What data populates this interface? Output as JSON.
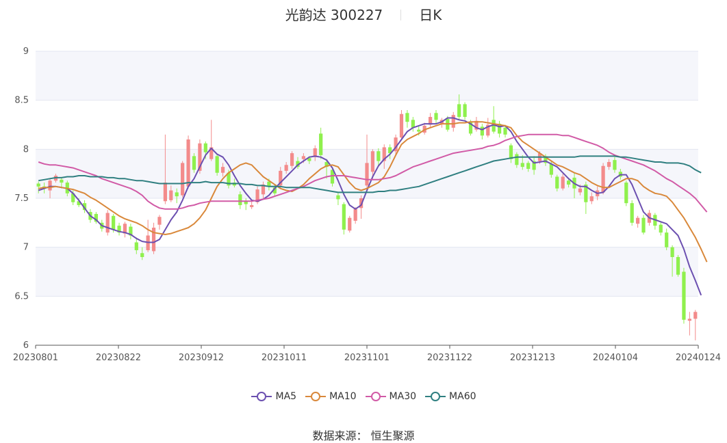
{
  "title": {
    "name": "光韵达 300227",
    "period": "日K"
  },
  "source": "数据来源：  恒生聚源",
  "chart_data": {
    "type": "candlestick",
    "ylim": [
      6,
      9
    ],
    "yticks": [
      "6",
      "6.5",
      "7",
      "7.5",
      "8",
      "8.5",
      "9"
    ],
    "xticks": [
      "20230801",
      "20230822",
      "20230912",
      "20231011",
      "20231101",
      "20231122",
      "20231213",
      "20240104",
      "20240124"
    ],
    "up_color": "#f38b8b",
    "down_color": "#8ff04d",
    "legend": [
      {
        "name": "MA5",
        "color": "#6b4fb0"
      },
      {
        "name": "MA10",
        "color": "#d9883a"
      },
      {
        "name": "MA30",
        "color": "#d15aa6"
      },
      {
        "name": "MA60",
        "color": "#2f7f80"
      }
    ],
    "candles": [
      [
        7.65,
        7.62,
        7.67,
        7.55
      ],
      [
        7.62,
        7.6,
        7.66,
        7.55
      ],
      [
        7.58,
        7.68,
        7.7,
        7.5
      ],
      [
        7.68,
        7.73,
        7.75,
        7.66
      ],
      [
        7.69,
        7.66,
        7.71,
        7.6
      ],
      [
        7.66,
        7.55,
        7.68,
        7.52
      ],
      [
        7.55,
        7.46,
        7.58,
        7.43
      ],
      [
        7.47,
        7.43,
        7.5,
        7.41
      ],
      [
        7.45,
        7.38,
        7.48,
        7.35
      ],
      [
        7.36,
        7.28,
        7.39,
        7.25
      ],
      [
        7.34,
        7.26,
        7.36,
        7.24
      ],
      [
        7.25,
        7.19,
        7.28,
        7.16
      ],
      [
        7.15,
        7.35,
        7.38,
        7.12
      ],
      [
        7.32,
        7.18,
        7.34,
        7.15
      ],
      [
        7.22,
        7.15,
        7.25,
        7.12
      ],
      [
        7.14,
        7.24,
        7.26,
        7.1
      ],
      [
        7.21,
        7.12,
        7.24,
        7.08
      ],
      [
        7.05,
        6.97,
        7.1,
        6.93
      ],
      [
        6.94,
        6.9,
        7.0,
        6.87
      ],
      [
        6.97,
        7.12,
        7.28,
        6.95
      ],
      [
        6.96,
        7.2,
        7.25,
        6.93
      ],
      [
        7.23,
        7.31,
        7.33,
        7.18
      ],
      [
        7.47,
        7.66,
        8.15,
        7.44
      ],
      [
        7.48,
        7.58,
        7.63,
        7.46
      ],
      [
        7.56,
        7.52,
        7.6,
        7.45
      ],
      [
        7.53,
        7.86,
        7.88,
        7.51
      ],
      [
        7.62,
        8.1,
        8.14,
        7.6
      ],
      [
        7.93,
        7.79,
        7.96,
        7.76
      ],
      [
        7.78,
        8.06,
        8.1,
        7.75
      ],
      [
        8.06,
        7.97,
        8.08,
        7.9
      ],
      [
        7.9,
        8.02,
        8.3,
        7.88
      ],
      [
        7.93,
        7.76,
        7.95,
        7.73
      ],
      [
        7.76,
        7.82,
        7.86,
        7.72
      ],
      [
        7.76,
        7.63,
        7.79,
        7.6
      ],
      [
        7.66,
        7.63,
        7.7,
        7.61
      ],
      [
        7.54,
        7.43,
        7.57,
        7.39
      ],
      [
        7.47,
        7.44,
        7.5,
        7.38
      ],
      [
        7.41,
        7.43,
        7.47,
        7.39
      ],
      [
        7.46,
        7.59,
        7.62,
        7.44
      ],
      [
        7.54,
        7.64,
        7.67,
        7.5
      ],
      [
        7.67,
        7.62,
        7.7,
        7.58
      ],
      [
        7.61,
        7.55,
        7.64,
        7.52
      ],
      [
        7.63,
        7.78,
        7.82,
        7.6
      ],
      [
        7.78,
        7.84,
        7.87,
        7.75
      ],
      [
        7.83,
        7.96,
        7.98,
        7.8
      ],
      [
        7.88,
        7.82,
        7.92,
        7.8
      ],
      [
        7.9,
        7.93,
        7.96,
        7.86
      ],
      [
        7.91,
        7.88,
        7.93,
        7.85
      ],
      [
        7.92,
        8.01,
        8.04,
        7.88
      ],
      [
        8.16,
        7.94,
        8.22,
        7.9
      ],
      [
        7.87,
        7.82,
        7.9,
        7.7
      ],
      [
        7.79,
        7.65,
        7.81,
        7.62
      ],
      [
        7.53,
        7.49,
        7.56,
        7.43
      ],
      [
        7.44,
        7.18,
        7.46,
        7.13
      ],
      [
        7.17,
        7.3,
        7.32,
        7.15
      ],
      [
        7.27,
        7.39,
        7.41,
        7.24
      ],
      [
        7.4,
        7.5,
        7.53,
        7.29
      ],
      [
        7.63,
        7.86,
        8.15,
        7.58
      ],
      [
        7.77,
        7.98,
        8.0,
        7.7
      ],
      [
        7.98,
        7.88,
        8.01,
        7.82
      ],
      [
        7.88,
        8.02,
        8.05,
        7.8
      ],
      [
        8.02,
        7.96,
        8.05,
        7.9
      ],
      [
        7.98,
        8.12,
        8.15,
        7.95
      ],
      [
        8.12,
        8.36,
        8.4,
        8.1
      ],
      [
        8.37,
        8.28,
        8.4,
        8.22
      ],
      [
        8.3,
        8.22,
        8.33,
        8.18
      ],
      [
        8.2,
        8.18,
        8.24,
        8.14
      ],
      [
        8.17,
        8.24,
        8.27,
        8.15
      ],
      [
        8.25,
        8.33,
        8.37,
        8.22
      ],
      [
        8.37,
        8.3,
        8.4,
        8.26
      ],
      [
        8.26,
        8.3,
        8.32,
        8.22
      ],
      [
        8.31,
        8.2,
        8.34,
        8.18
      ],
      [
        8.22,
        8.35,
        8.38,
        8.18
      ],
      [
        8.46,
        8.33,
        8.56,
        8.3
      ],
      [
        8.46,
        8.33,
        8.48,
        8.3
      ],
      [
        8.28,
        8.16,
        8.3,
        8.14
      ],
      [
        8.2,
        8.29,
        8.33,
        8.18
      ],
      [
        8.23,
        8.14,
        8.26,
        8.1
      ],
      [
        8.14,
        8.25,
        8.32,
        8.12
      ],
      [
        8.3,
        8.18,
        8.44,
        8.16
      ],
      [
        8.26,
        8.16,
        8.29,
        8.12
      ],
      [
        8.22,
        8.15,
        8.25,
        8.12
      ],
      [
        8.04,
        7.9,
        8.06,
        7.86
      ],
      [
        7.95,
        7.84,
        7.97,
        7.81
      ],
      [
        7.86,
        7.82,
        7.94,
        7.79
      ],
      [
        7.86,
        7.8,
        7.88,
        7.77
      ],
      [
        7.88,
        7.79,
        7.93,
        7.74
      ],
      [
        7.88,
        7.96,
        7.98,
        7.85
      ],
      [
        7.93,
        7.86,
        7.95,
        7.83
      ],
      [
        7.85,
        7.74,
        7.88,
        7.71
      ],
      [
        7.72,
        7.6,
        7.74,
        7.57
      ],
      [
        7.6,
        7.72,
        7.75,
        7.58
      ],
      [
        7.68,
        7.64,
        7.71,
        7.61
      ],
      [
        7.71,
        7.6,
        7.76,
        7.5
      ],
      [
        7.56,
        7.6,
        7.64,
        7.53
      ],
      [
        7.64,
        7.46,
        7.67,
        7.34
      ],
      [
        7.47,
        7.52,
        7.56,
        7.44
      ],
      [
        7.52,
        7.58,
        7.62,
        7.48
      ],
      [
        7.56,
        7.83,
        7.86,
        7.54
      ],
      [
        7.82,
        7.87,
        7.9,
        7.79
      ],
      [
        7.89,
        7.79,
        7.92,
        7.76
      ],
      [
        7.77,
        7.72,
        7.8,
        7.69
      ],
      [
        7.66,
        7.45,
        7.68,
        7.42
      ],
      [
        7.45,
        7.25,
        7.48,
        7.22
      ],
      [
        7.24,
        7.3,
        7.32,
        7.2
      ],
      [
        7.3,
        7.15,
        7.33,
        7.13
      ],
      [
        7.25,
        7.35,
        7.38,
        7.22
      ],
      [
        7.33,
        7.22,
        7.35,
        7.18
      ],
      [
        7.23,
        7.15,
        7.26,
        7.12
      ],
      [
        7.15,
        7.0,
        7.19,
        6.97
      ],
      [
        7.0,
        6.9,
        7.02,
        6.7
      ],
      [
        6.9,
        6.72,
        6.92,
        6.7
      ],
      [
        6.75,
        6.26,
        6.79,
        6.22
      ],
      [
        6.25,
        6.27,
        6.34,
        6.1
      ],
      [
        6.27,
        6.34,
        6.36,
        6.05
      ]
    ],
    "ma": {
      "MA5": [
        7.58,
        7.6,
        7.62,
        7.62,
        7.61,
        7.6,
        7.55,
        7.48,
        7.4,
        7.32,
        7.28,
        7.22,
        7.2,
        7.18,
        7.16,
        7.15,
        7.13,
        7.09,
        7.06,
        7.05,
        7.05,
        7.08,
        7.18,
        7.28,
        7.36,
        7.48,
        7.62,
        7.7,
        7.82,
        7.94,
        8.01,
        7.95,
        7.92,
        7.84,
        7.73,
        7.63,
        7.55,
        7.48,
        7.47,
        7.49,
        7.53,
        7.6,
        7.66,
        7.72,
        7.78,
        7.84,
        7.88,
        7.92,
        7.93,
        7.92,
        7.89,
        7.81,
        7.68,
        7.54,
        7.43,
        7.39,
        7.43,
        7.58,
        7.72,
        7.83,
        7.9,
        7.95,
        8.02,
        8.1,
        8.18,
        8.22,
        8.24,
        8.26,
        8.26,
        8.26,
        8.28,
        8.32,
        8.32,
        8.3,
        8.29,
        8.26,
        8.22,
        8.2,
        8.23,
        8.25,
        8.23,
        8.24,
        8.18,
        8.08,
        8.0,
        7.92,
        7.86,
        7.87,
        7.88,
        7.85,
        7.82,
        7.76,
        7.7,
        7.65,
        7.62,
        7.62,
        7.58,
        7.55,
        7.56,
        7.62,
        7.7,
        7.74,
        7.74,
        7.64,
        7.5,
        7.36,
        7.3,
        7.28,
        7.26,
        7.24,
        7.18,
        7.12,
        6.98,
        6.8,
        6.66,
        6.51
      ],
      "MA10": [
        7.6,
        7.61,
        7.61,
        7.62,
        7.61,
        7.6,
        7.59,
        7.57,
        7.55,
        7.51,
        7.48,
        7.44,
        7.4,
        7.36,
        7.32,
        7.29,
        7.27,
        7.25,
        7.22,
        7.18,
        7.15,
        7.14,
        7.13,
        7.14,
        7.16,
        7.18,
        7.2,
        7.24,
        7.3,
        7.38,
        7.5,
        7.62,
        7.7,
        7.76,
        7.8,
        7.84,
        7.86,
        7.84,
        7.78,
        7.72,
        7.68,
        7.64,
        7.6,
        7.58,
        7.57,
        7.6,
        7.64,
        7.7,
        7.75,
        7.8,
        7.83,
        7.84,
        7.82,
        7.74,
        7.66,
        7.6,
        7.58,
        7.6,
        7.63,
        7.66,
        7.72,
        7.82,
        7.94,
        8.05,
        8.1,
        8.13,
        8.16,
        8.2,
        8.22,
        8.24,
        8.26,
        8.26,
        8.26,
        8.27,
        8.27,
        8.28,
        8.28,
        8.28,
        8.27,
        8.26,
        8.25,
        8.24,
        8.22,
        8.14,
        8.08,
        8.04,
        8.0,
        7.96,
        7.92,
        7.88,
        7.84,
        7.82,
        7.79,
        7.76,
        7.74,
        7.7,
        7.66,
        7.63,
        7.61,
        7.61,
        7.64,
        7.67,
        7.7,
        7.7,
        7.68,
        7.62,
        7.58,
        7.55,
        7.54,
        7.52,
        7.46,
        7.38,
        7.3,
        7.2,
        7.1,
        6.98,
        6.85
      ],
      "MA30": [
        7.87,
        7.85,
        7.84,
        7.84,
        7.83,
        7.82,
        7.81,
        7.79,
        7.77,
        7.75,
        7.73,
        7.7,
        7.68,
        7.66,
        7.64,
        7.62,
        7.6,
        7.57,
        7.53,
        7.47,
        7.43,
        7.4,
        7.39,
        7.39,
        7.39,
        7.4,
        7.42,
        7.43,
        7.45,
        7.46,
        7.47,
        7.47,
        7.47,
        7.47,
        7.47,
        7.47,
        7.47,
        7.47,
        7.48,
        7.49,
        7.5,
        7.52,
        7.54,
        7.56,
        7.58,
        7.6,
        7.62,
        7.65,
        7.68,
        7.7,
        7.72,
        7.73,
        7.73,
        7.73,
        7.72,
        7.71,
        7.7,
        7.69,
        7.69,
        7.69,
        7.7,
        7.71,
        7.73,
        7.76,
        7.79,
        7.82,
        7.84,
        7.86,
        7.88,
        7.9,
        7.92,
        7.94,
        7.96,
        7.97,
        7.98,
        7.99,
        8.0,
        8.01,
        8.03,
        8.04,
        8.06,
        8.09,
        8.11,
        8.13,
        8.14,
        8.15,
        8.15,
        8.15,
        8.15,
        8.15,
        8.15,
        8.14,
        8.14,
        8.12,
        8.1,
        8.08,
        8.06,
        8.04,
        8.01,
        7.97,
        7.94,
        7.92,
        7.9,
        7.88,
        7.86,
        7.84,
        7.81,
        7.78,
        7.74,
        7.7,
        7.67,
        7.63,
        7.59,
        7.55,
        7.5,
        7.43,
        7.36
      ],
      "MA60": [
        7.68,
        7.69,
        7.7,
        7.71,
        7.71,
        7.72,
        7.72,
        7.73,
        7.73,
        7.72,
        7.72,
        7.72,
        7.71,
        7.71,
        7.7,
        7.7,
        7.69,
        7.68,
        7.68,
        7.67,
        7.66,
        7.65,
        7.65,
        7.65,
        7.65,
        7.65,
        7.66,
        7.66,
        7.66,
        7.67,
        7.66,
        7.66,
        7.66,
        7.65,
        7.65,
        7.65,
        7.64,
        7.64,
        7.63,
        7.63,
        7.62,
        7.62,
        7.62,
        7.61,
        7.61,
        7.61,
        7.61,
        7.61,
        7.6,
        7.59,
        7.58,
        7.57,
        7.56,
        7.56,
        7.56,
        7.56,
        7.56,
        7.56,
        7.56,
        7.57,
        7.57,
        7.58,
        7.58,
        7.59,
        7.6,
        7.61,
        7.62,
        7.64,
        7.66,
        7.68,
        7.7,
        7.72,
        7.74,
        7.76,
        7.78,
        7.8,
        7.82,
        7.84,
        7.86,
        7.88,
        7.89,
        7.9,
        7.91,
        7.92,
        7.92,
        7.92,
        7.92,
        7.92,
        7.92,
        7.92,
        7.92,
        7.92,
        7.92,
        7.92,
        7.93,
        7.93,
        7.93,
        7.93,
        7.93,
        7.93,
        7.93,
        7.92,
        7.92,
        7.91,
        7.9,
        7.89,
        7.88,
        7.87,
        7.87,
        7.86,
        7.86,
        7.86,
        7.85,
        7.83,
        7.79,
        7.76
      ]
    }
  }
}
